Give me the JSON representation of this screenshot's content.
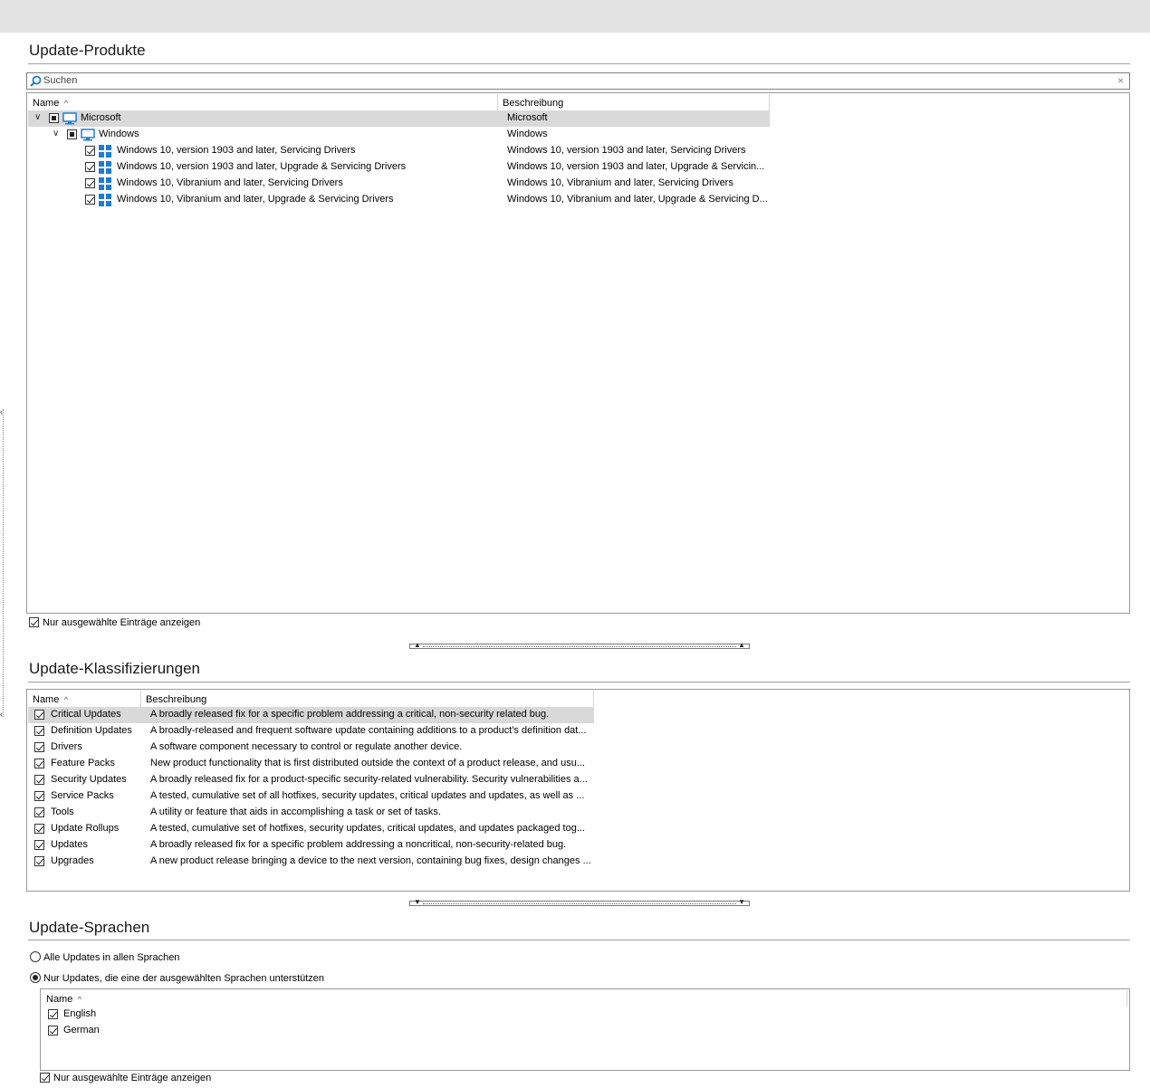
{
  "products": {
    "title": "Update-Produkte",
    "search_placeholder": "Suchen",
    "col_name": "Name",
    "col_desc": "Beschreibung",
    "tree": [
      {
        "name": "Microsoft",
        "desc": "Microsoft",
        "state": "partial",
        "icon": "monitor-icon",
        "level": 0,
        "expanded": true
      },
      {
        "name": "Windows",
        "desc": "Windows",
        "state": "partial",
        "icon": "monitor-icon",
        "level": 1,
        "expanded": true
      },
      {
        "name": "Windows 10, version 1903 and later, Servicing Drivers",
        "desc": "Windows 10, version 1903 and later, Servicing Drivers",
        "state": "checked",
        "icon": "windows-icon",
        "level": 2
      },
      {
        "name": "Windows 10, version 1903 and later, Upgrade & Servicing Drivers",
        "desc": "Windows 10, version 1903 and later, Upgrade & Servicin...",
        "state": "checked",
        "icon": "windows-icon",
        "level": 2
      },
      {
        "name": "Windows 10, Vibranium and later, Servicing Drivers",
        "desc": "Windows 10, Vibranium and later, Servicing Drivers",
        "state": "checked",
        "icon": "windows-icon",
        "level": 2
      },
      {
        "name": "Windows 10, Vibranium and later, Upgrade & Servicing Drivers",
        "desc": "Windows 10, Vibranium and later, Upgrade & Servicing D...",
        "state": "checked",
        "icon": "windows-icon",
        "level": 2
      }
    ],
    "only_selected_label": "Nur ausgewählte Einträge anzeigen"
  },
  "classifications": {
    "title": "Update-Klassifizierungen",
    "col_name": "Name",
    "col_desc": "Beschreibung",
    "rows": [
      {
        "name": "Critical Updates",
        "desc": "A broadly released fix for a specific problem addressing a critical, non-security related bug."
      },
      {
        "name": "Definition Updates",
        "desc": "A broadly-released and frequent software update containing additions to a product's definition dat..."
      },
      {
        "name": "Drivers",
        "desc": "A software component necessary to control or regulate another device."
      },
      {
        "name": "Feature Packs",
        "desc": "New product functionality that is first distributed outside the context of a product release, and usu..."
      },
      {
        "name": "Security Updates",
        "desc": "A broadly released fix for a product-specific security-related vulnerability. Security vulnerabilities a..."
      },
      {
        "name": "Service Packs",
        "desc": "A tested, cumulative set of all hotfixes, security updates, critical updates and updates, as well as ..."
      },
      {
        "name": "Tools",
        "desc": "A utility or feature that aids in accomplishing a task or set of tasks."
      },
      {
        "name": "Update Rollups",
        "desc": "A tested, cumulative set of hotfixes, security updates, critical updates, and updates packaged tog..."
      },
      {
        "name": "Updates",
        "desc": "A broadly released fix for a specific problem addressing a noncritical, non-security-related bug."
      },
      {
        "name": "Upgrades",
        "desc": "A new product release bringing a device to the next version, containing bug fixes, design changes ..."
      }
    ]
  },
  "languages": {
    "title": "Update-Sprachen",
    "radio_all": "Alle Updates in allen Sprachen",
    "radio_selected": "Nur Updates, die eine der ausgewählten Sprachen unterstützen",
    "col_name": "Name",
    "items": [
      "English",
      "German"
    ],
    "only_selected_label": "Nur ausgewählte Einträge anzeigen"
  },
  "colors": {
    "accent": "#1e7bd4",
    "selection": "#d9d9d9",
    "header_bar": "#e3e3e3"
  }
}
